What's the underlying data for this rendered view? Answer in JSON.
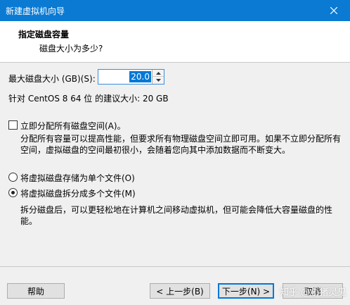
{
  "window": {
    "title": "新建虚拟机向导",
    "close_icon": "close-icon"
  },
  "header": {
    "title": "指定磁盘容量",
    "subtitle": "磁盘大小为多少?"
  },
  "disk_size": {
    "label": "最大磁盘大小 (GB)(S):",
    "value": "20.0"
  },
  "recommendation": "针对 CentOS 8 64 位 的建议大小: 20 GB",
  "allocate": {
    "label": "立即分配所有磁盘空间(A)。",
    "checked": false,
    "desc_line1": "分配所有容量可以提高性能，但要求所有物理磁盘空间立即可用。如果不立即分配所有",
    "desc_line2": "空间，虚拟磁盘的空间最初很小，会随着您向其中添加数据而不断变大。"
  },
  "storage": {
    "single_label": "将虚拟磁盘存储为单个文件(O)",
    "multi_label": "将虚拟磁盘拆分成多个文件(M)",
    "selected": "multi",
    "multi_desc_line1": "拆分磁盘后，可以更轻松地在计算机之间移动虚拟机，但可能会降低大容量磁盘的性",
    "multi_desc_line2": "能。"
  },
  "buttons": {
    "help": "帮助",
    "back": "< 上一步(B)",
    "next": "下一步(N) >",
    "cancel": "取消"
  },
  "watermark": "知乎 @小猪灵鬼"
}
